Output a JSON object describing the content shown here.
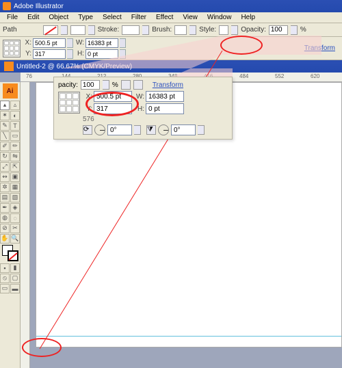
{
  "app": {
    "title": "Adobe Illustrator"
  },
  "menu": [
    "File",
    "Edit",
    "Object",
    "Type",
    "Select",
    "Filter",
    "Effect",
    "View",
    "Window",
    "Help"
  ],
  "options": {
    "path": "Path",
    "stroke": "Stroke:",
    "brush": "Brush:",
    "style": "Style:",
    "opacity": "Opacity:",
    "opacity_val": "100",
    "pct": "%"
  },
  "transform": {
    "link": "Transform",
    "x_label": "X:",
    "y_label": "Y:",
    "w_label": "W:",
    "h_label": "H:",
    "x": "500.5 pt",
    "y": "317",
    "w": "16383 pt",
    "h": "0 pt",
    "angle1": "0°",
    "angle2": "0°"
  },
  "document": {
    "title": "Untitled-2 @ 66.67% (CMYK/Preview)"
  },
  "ruler": {
    "start": 76,
    "step": 68,
    "labels": [
      "76",
      "144",
      "212",
      "280",
      "348",
      "416",
      "484",
      "552",
      "620"
    ]
  },
  "zoom": {
    "opacity_label": "pacity:",
    "opacity_val": "100",
    "pct": "%",
    "link": "Transform",
    "ruler_marks": [
      "",
      "576",
      ""
    ],
    "x_label": "X:",
    "y_label": "Y:",
    "w_label": "W:",
    "h_label": "H:",
    "x": "500.5 pt",
    "y": "317",
    "w": "16383 pt",
    "h": "0 pt",
    "ang1": "0°",
    "ang2": "0°"
  },
  "icons": {
    "ai": "Ai"
  }
}
